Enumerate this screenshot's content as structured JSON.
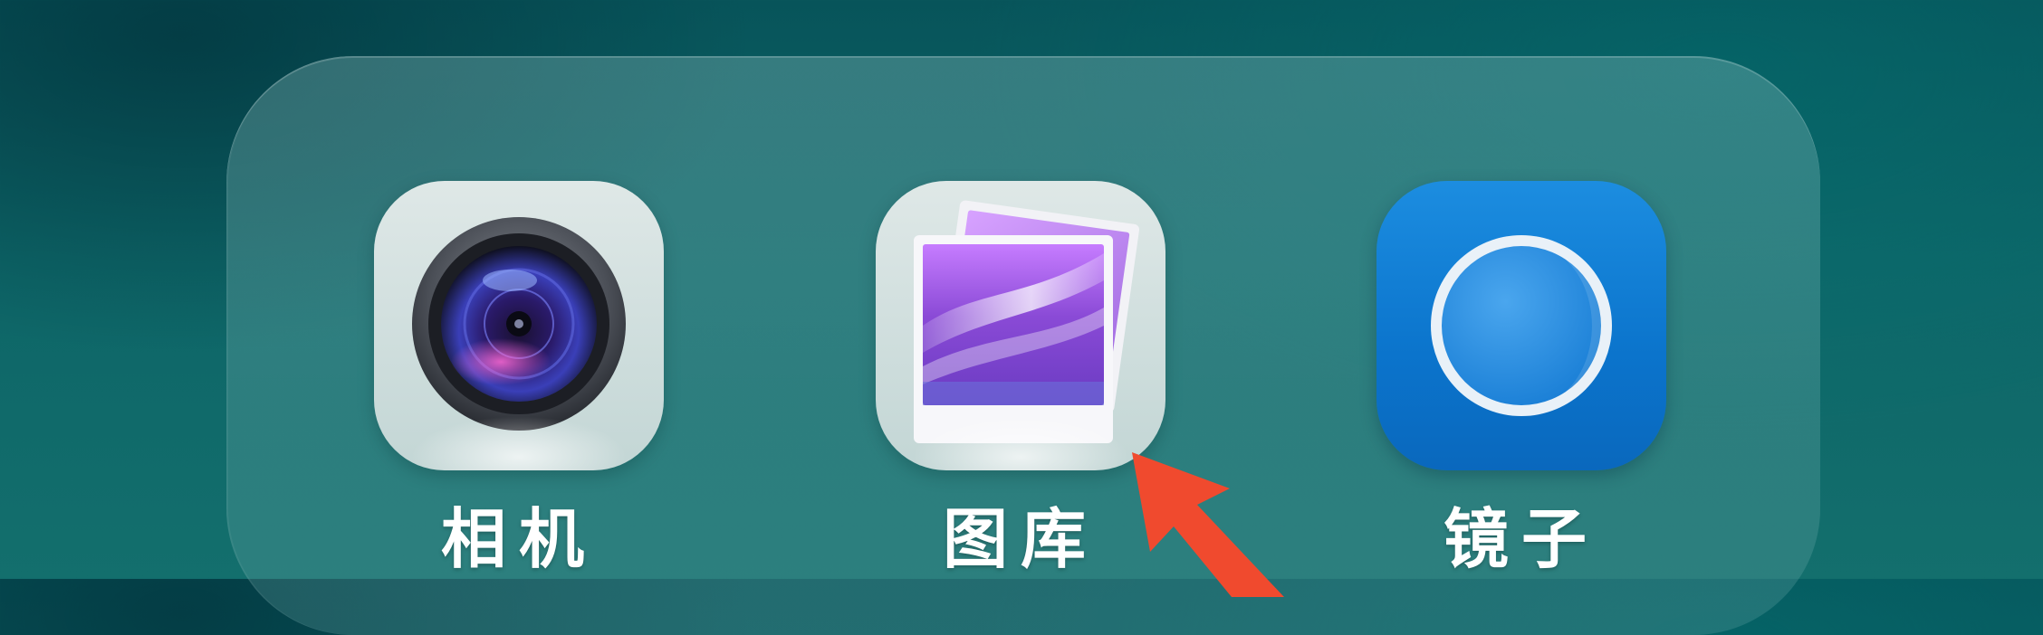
{
  "folder": {
    "apps": [
      {
        "id": "camera",
        "label": "相机"
      },
      {
        "id": "gallery",
        "label": "图库"
      },
      {
        "id": "mirror",
        "label": "镜子"
      }
    ]
  },
  "colors": {
    "background": "#0d6567",
    "mirror_tile": "#0b74cc",
    "arrow": "#f04a2e",
    "label": "#ffffff"
  },
  "icons": {
    "camera": "camera-lens-icon",
    "gallery": "photo-stack-icon",
    "mirror": "mirror-circle-icon",
    "pointer": "red-arrow-pointer"
  }
}
